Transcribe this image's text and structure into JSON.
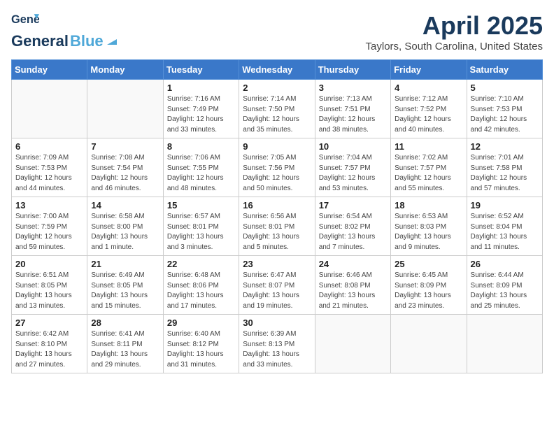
{
  "header": {
    "logo_line1": "General",
    "logo_line2": "Blue",
    "main_title": "April 2025",
    "subtitle": "Taylors, South Carolina, United States"
  },
  "days_of_week": [
    "Sunday",
    "Monday",
    "Tuesday",
    "Wednesday",
    "Thursday",
    "Friday",
    "Saturday"
  ],
  "weeks": [
    [
      {
        "day": "",
        "info": ""
      },
      {
        "day": "",
        "info": ""
      },
      {
        "day": "1",
        "info": "Sunrise: 7:16 AM\nSunset: 7:49 PM\nDaylight: 12 hours and 33 minutes."
      },
      {
        "day": "2",
        "info": "Sunrise: 7:14 AM\nSunset: 7:50 PM\nDaylight: 12 hours and 35 minutes."
      },
      {
        "day": "3",
        "info": "Sunrise: 7:13 AM\nSunset: 7:51 PM\nDaylight: 12 hours and 38 minutes."
      },
      {
        "day": "4",
        "info": "Sunrise: 7:12 AM\nSunset: 7:52 PM\nDaylight: 12 hours and 40 minutes."
      },
      {
        "day": "5",
        "info": "Sunrise: 7:10 AM\nSunset: 7:53 PM\nDaylight: 12 hours and 42 minutes."
      }
    ],
    [
      {
        "day": "6",
        "info": "Sunrise: 7:09 AM\nSunset: 7:53 PM\nDaylight: 12 hours and 44 minutes."
      },
      {
        "day": "7",
        "info": "Sunrise: 7:08 AM\nSunset: 7:54 PM\nDaylight: 12 hours and 46 minutes."
      },
      {
        "day": "8",
        "info": "Sunrise: 7:06 AM\nSunset: 7:55 PM\nDaylight: 12 hours and 48 minutes."
      },
      {
        "day": "9",
        "info": "Sunrise: 7:05 AM\nSunset: 7:56 PM\nDaylight: 12 hours and 50 minutes."
      },
      {
        "day": "10",
        "info": "Sunrise: 7:04 AM\nSunset: 7:57 PM\nDaylight: 12 hours and 53 minutes."
      },
      {
        "day": "11",
        "info": "Sunrise: 7:02 AM\nSunset: 7:57 PM\nDaylight: 12 hours and 55 minutes."
      },
      {
        "day": "12",
        "info": "Sunrise: 7:01 AM\nSunset: 7:58 PM\nDaylight: 12 hours and 57 minutes."
      }
    ],
    [
      {
        "day": "13",
        "info": "Sunrise: 7:00 AM\nSunset: 7:59 PM\nDaylight: 12 hours and 59 minutes."
      },
      {
        "day": "14",
        "info": "Sunrise: 6:58 AM\nSunset: 8:00 PM\nDaylight: 13 hours and 1 minute."
      },
      {
        "day": "15",
        "info": "Sunrise: 6:57 AM\nSunset: 8:01 PM\nDaylight: 13 hours and 3 minutes."
      },
      {
        "day": "16",
        "info": "Sunrise: 6:56 AM\nSunset: 8:01 PM\nDaylight: 13 hours and 5 minutes."
      },
      {
        "day": "17",
        "info": "Sunrise: 6:54 AM\nSunset: 8:02 PM\nDaylight: 13 hours and 7 minutes."
      },
      {
        "day": "18",
        "info": "Sunrise: 6:53 AM\nSunset: 8:03 PM\nDaylight: 13 hours and 9 minutes."
      },
      {
        "day": "19",
        "info": "Sunrise: 6:52 AM\nSunset: 8:04 PM\nDaylight: 13 hours and 11 minutes."
      }
    ],
    [
      {
        "day": "20",
        "info": "Sunrise: 6:51 AM\nSunset: 8:05 PM\nDaylight: 13 hours and 13 minutes."
      },
      {
        "day": "21",
        "info": "Sunrise: 6:49 AM\nSunset: 8:05 PM\nDaylight: 13 hours and 15 minutes."
      },
      {
        "day": "22",
        "info": "Sunrise: 6:48 AM\nSunset: 8:06 PM\nDaylight: 13 hours and 17 minutes."
      },
      {
        "day": "23",
        "info": "Sunrise: 6:47 AM\nSunset: 8:07 PM\nDaylight: 13 hours and 19 minutes."
      },
      {
        "day": "24",
        "info": "Sunrise: 6:46 AM\nSunset: 8:08 PM\nDaylight: 13 hours and 21 minutes."
      },
      {
        "day": "25",
        "info": "Sunrise: 6:45 AM\nSunset: 8:09 PM\nDaylight: 13 hours and 23 minutes."
      },
      {
        "day": "26",
        "info": "Sunrise: 6:44 AM\nSunset: 8:09 PM\nDaylight: 13 hours and 25 minutes."
      }
    ],
    [
      {
        "day": "27",
        "info": "Sunrise: 6:42 AM\nSunset: 8:10 PM\nDaylight: 13 hours and 27 minutes."
      },
      {
        "day": "28",
        "info": "Sunrise: 6:41 AM\nSunset: 8:11 PM\nDaylight: 13 hours and 29 minutes."
      },
      {
        "day": "29",
        "info": "Sunrise: 6:40 AM\nSunset: 8:12 PM\nDaylight: 13 hours and 31 minutes."
      },
      {
        "day": "30",
        "info": "Sunrise: 6:39 AM\nSunset: 8:13 PM\nDaylight: 13 hours and 33 minutes."
      },
      {
        "day": "",
        "info": ""
      },
      {
        "day": "",
        "info": ""
      },
      {
        "day": "",
        "info": ""
      }
    ]
  ]
}
